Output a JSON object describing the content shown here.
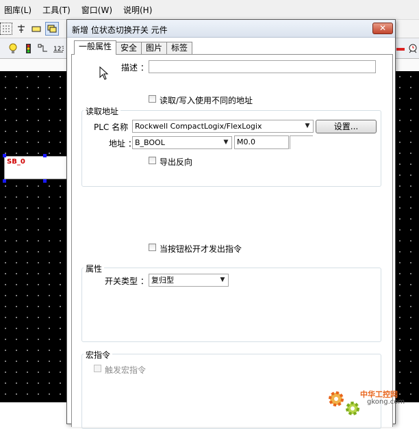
{
  "menubar": {
    "items": [
      "图库(L)",
      "工具(T)",
      "窗口(W)",
      "说明(H)"
    ]
  },
  "canvas": {
    "element_label": "SB_0"
  },
  "dialog": {
    "title": "新增 位状态切换开关 元件",
    "close_glyph": "✕",
    "tabs": [
      {
        "label": "一般属性",
        "active": true
      },
      {
        "label": "安全",
        "active": false
      },
      {
        "label": "图片",
        "active": false
      },
      {
        "label": "标签",
        "active": false
      }
    ],
    "description": {
      "label": "描述 ：",
      "value": ""
    },
    "rw_diff_address": {
      "label": "读取/写入使用不同的地址",
      "checked": false
    },
    "read_address": {
      "group_title": "读取地址",
      "plc_label": "PLC 名称 ：",
      "plc_value": "Rockwell CompactLogix/FlexLogix",
      "settings_button": "设置...",
      "address_label": "地址 ：",
      "address_type": "B_BOOL",
      "address_value": "M0.0",
      "invert_output": {
        "label": "导出反向",
        "checked": false
      }
    },
    "release_trigger": {
      "label": "当按钮松开才发出指令",
      "checked": false
    },
    "attributes": {
      "group_title": "属性",
      "switch_type_label": "开关类型 ：",
      "switch_type_value": "复归型"
    },
    "macro": {
      "group_title": "宏指令",
      "trigger_macro": {
        "label": "触发宏指令",
        "checked": false,
        "enabled": false
      }
    }
  },
  "watermark": {
    "line1": "中华工控网",
    "line2": "gkong.com"
  },
  "colors": {
    "canvas_bg": "#000000",
    "element_label": "#d00000",
    "close_button": "#c2452d",
    "watermark": "#e8641a"
  }
}
